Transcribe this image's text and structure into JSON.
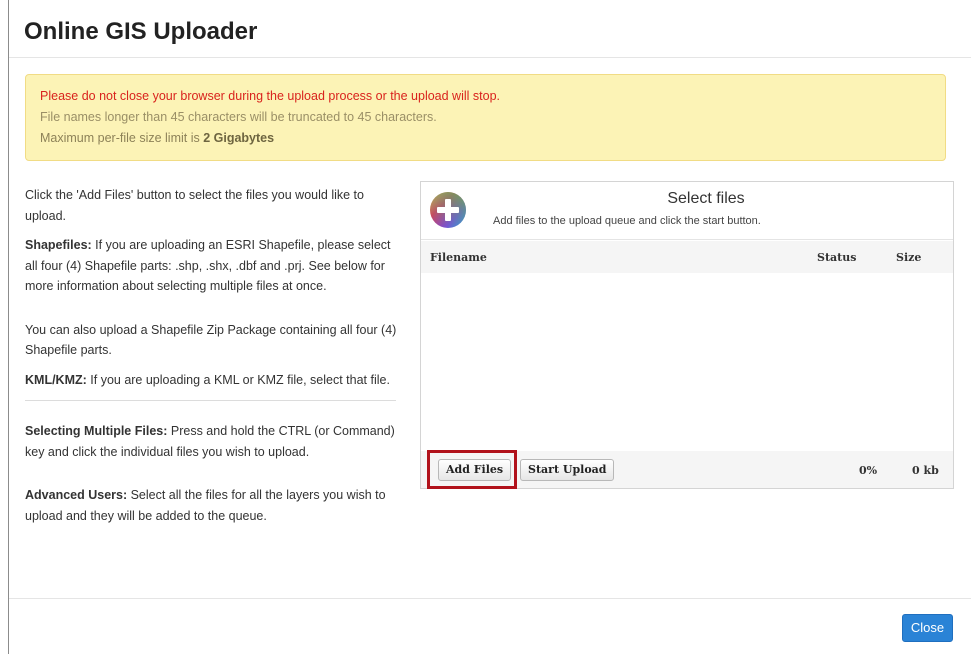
{
  "dialog": {
    "title": "Online GIS Uploader",
    "close_label": "Close"
  },
  "alert": {
    "line1": "Please do not close your browser during the upload process or the upload will stop.",
    "line2": "File names longer than 45 characters will be truncated to 45 characters.",
    "line3_prefix": "Maximum per-file size limit is ",
    "line3_bold": "2 Gigabytes"
  },
  "instructions": {
    "intro": "Click the 'Add Files' button to select the files you would like to upload.",
    "shapefiles_label": "Shapefiles:",
    "shapefiles_text": " If you are uploading an ESRI Shapefile, please select all four (4) Shapefile parts: .shp, .shx, .dbf and .prj. See below for more information about selecting multiple files at once.",
    "zip_text": "You can also upload a Shapefile Zip Package containing all four (4) Shapefile parts.",
    "kml_label": "KML/KMZ:",
    "kml_text": " If you are uploading a KML or KMZ file, select that file.",
    "multiple_label": "Selecting Multiple Files:",
    "multiple_text": " Press and hold the CTRL (or Command) key and click the individual files you wish to upload.",
    "advanced_label": "Advanced Users:",
    "advanced_text": " Select all the files for all the layers you wish to upload and they will be added to the queue."
  },
  "uploader": {
    "icon": "add-plus-icon",
    "title": "Select files",
    "subtitle": "Add files to the upload queue and click the start button.",
    "columns": [
      "Filename",
      "Status",
      "Size"
    ],
    "add_files_label": "Add Files",
    "start_upload_label": "Start Upload",
    "percent": "0%",
    "total_size": "0 kb"
  },
  "colors": {
    "alert_background": "#fcf3b6",
    "alert_warning_text": "#d9231d",
    "highlight": "#b1121b",
    "primary_button": "#2a83d6"
  }
}
